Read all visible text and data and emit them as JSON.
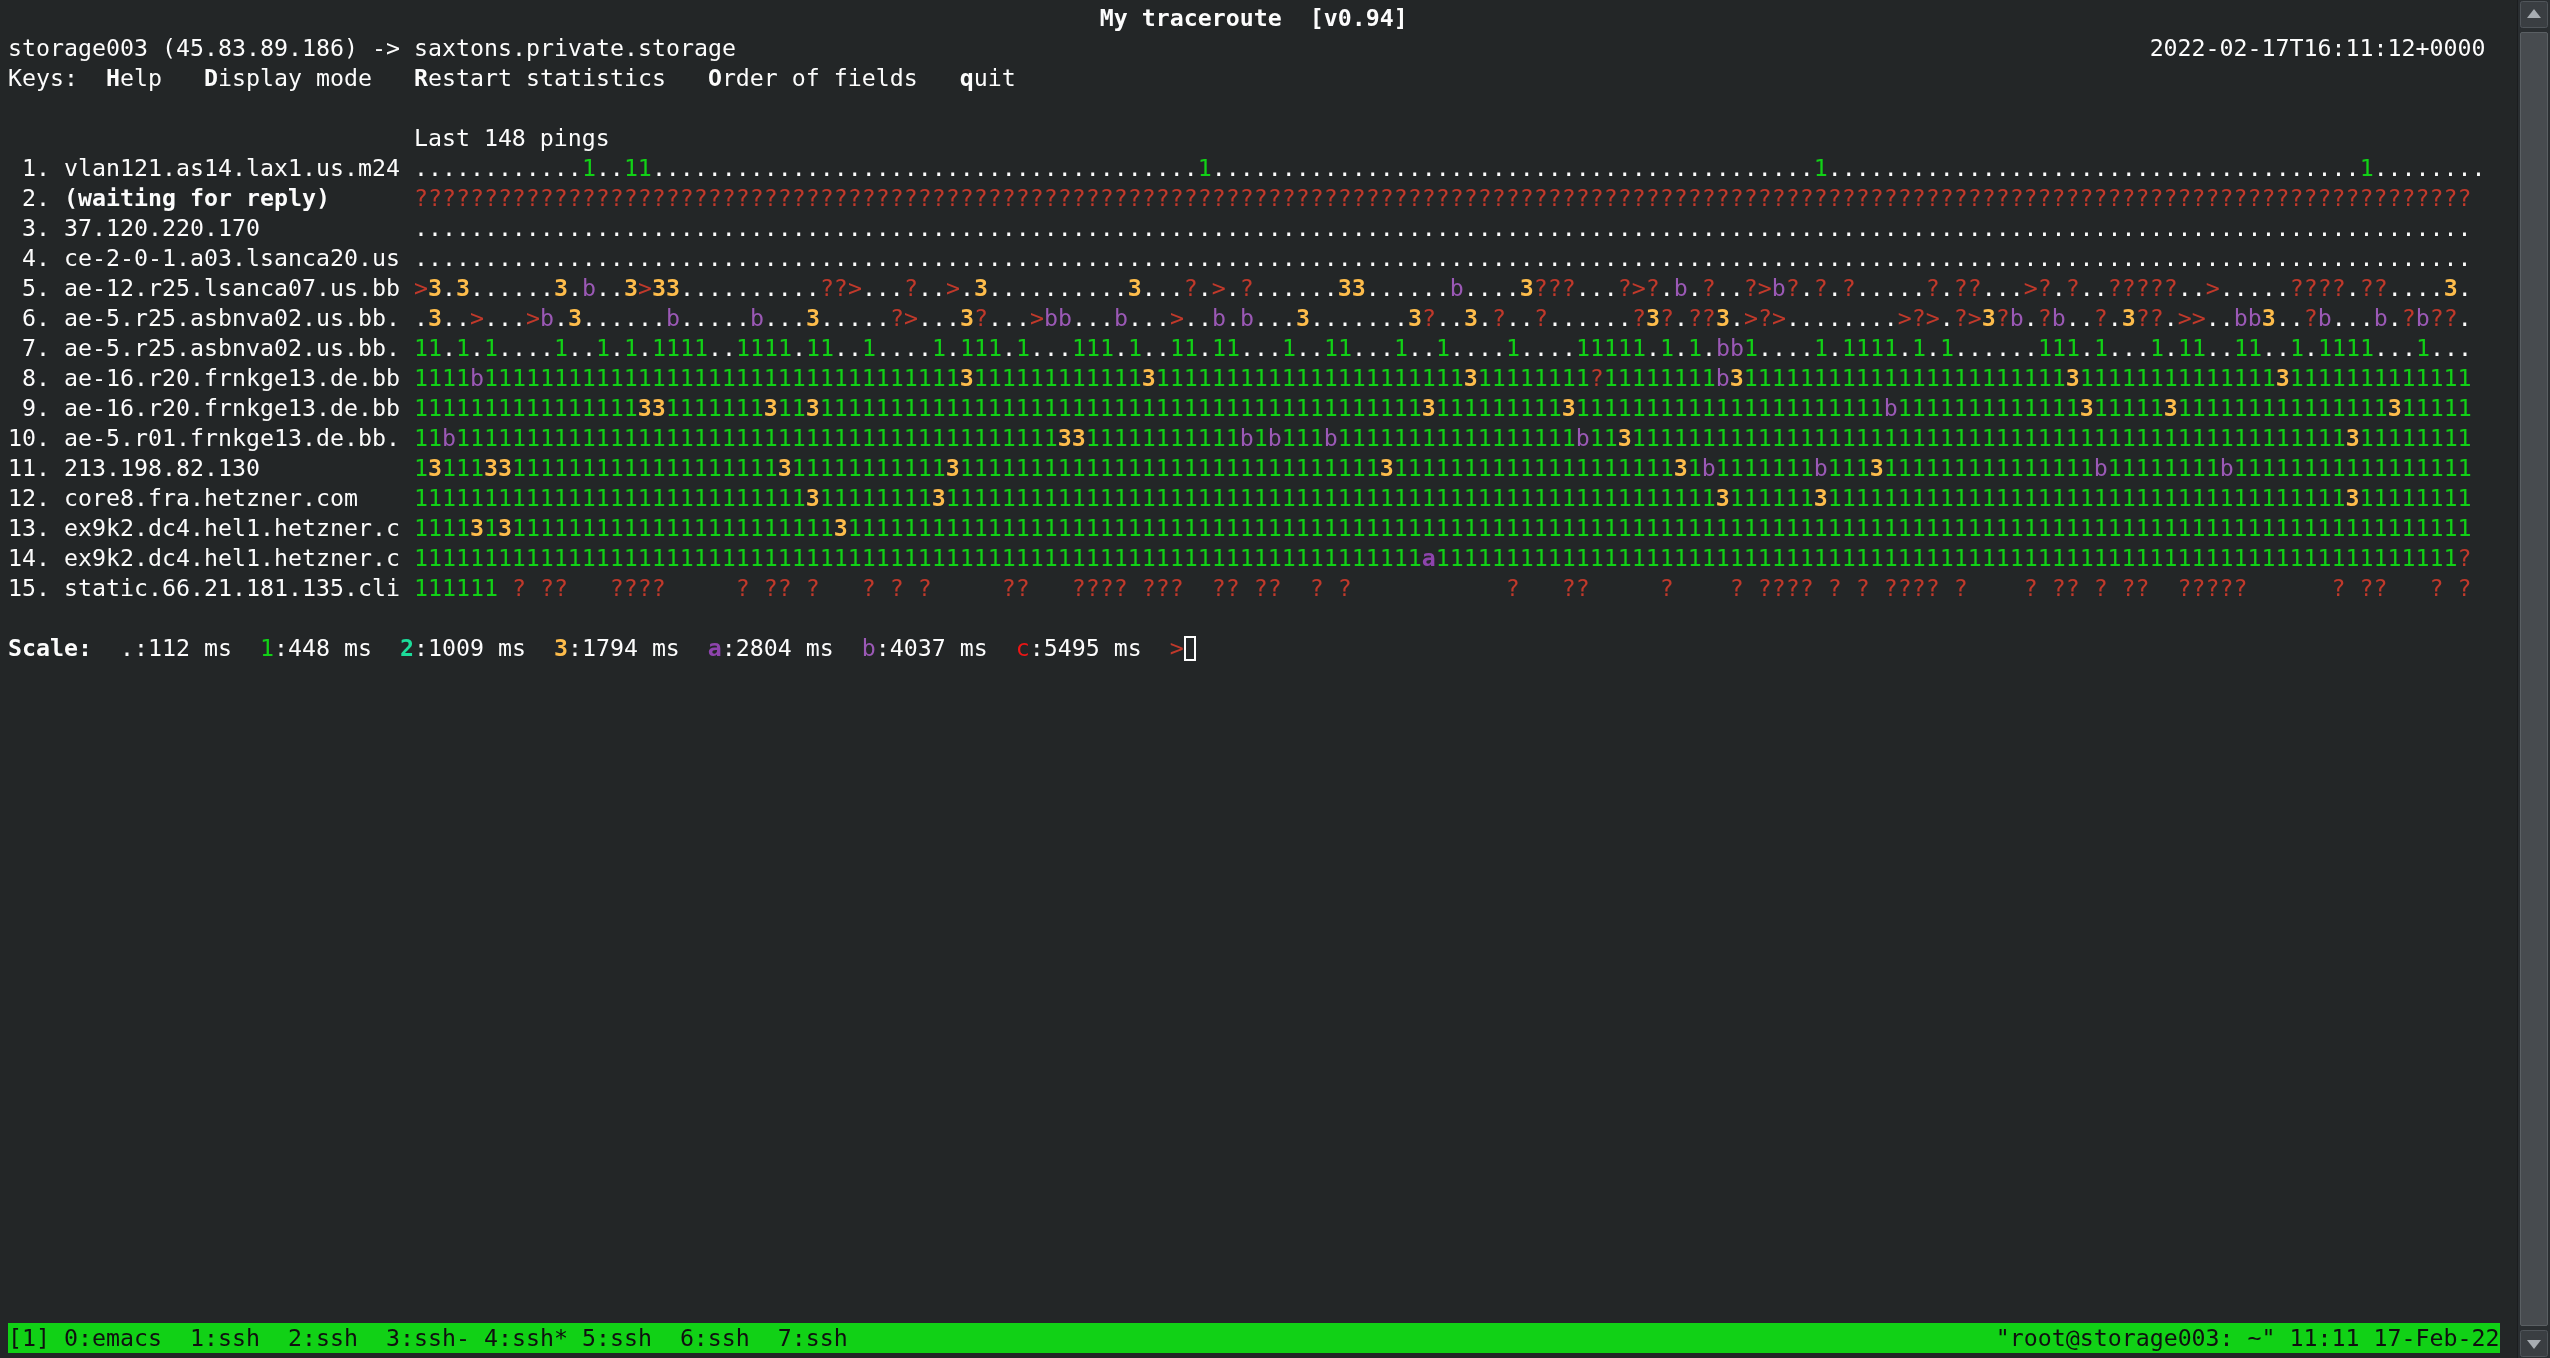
{
  "title": "My traceroute  [v0.94]",
  "route": "storage003 (45.83.89.186) -> saxtons.private.storage",
  "timestamp": "2022-02-17T16:11:12+0000",
  "keys": {
    "label": "Keys:",
    "items": [
      "**H**elp",
      "**D**isplay mode",
      "**R**estart statistics",
      "**O**rder of fields",
      "**q**uit"
    ]
  },
  "ping_header": "Last 148 pings",
  "hops": [
    {
      "number": "1.",
      "kind": "host",
      "host": "vlan121.as14.lax1.us.m24",
      "pings": "............1..11.......................................1...........................................1......................................1........"
    },
    {
      "number": "2.",
      "kind": "waiting",
      "host": "(waiting for reply)",
      "pings": "???????????????????????????????????????????????????????????????????????????????????????????????????????????????????????????????????????????????????"
    },
    {
      "number": "3.",
      "kind": "host",
      "host": "37.120.220.170",
      "pings": "..................................................................................................................................................."
    },
    {
      "number": "4.",
      "kind": "host",
      "host": "ce-2-0-1.a03.lsanca20.us",
      "pings": "..................................................................................................................................................."
    },
    {
      "number": "5.",
      "kind": "host",
      "host": "ae-12.r25.lsanca07.us.bb",
      "pings": ">3.3......3.b..3>33..........??>...?..>.3..........3...?.>.?......33......b....3???...?>?.b.?..?>b?.?.?.....?.??...>?.?..?????..>.....????.??....3."
    },
    {
      "number": "6.",
      "kind": "host",
      "host": "ae-5.r25.asbnva02.us.bb.",
      "pings": ".3..>...>b.3......b.....b...3.....?>...3?...>bb...b...>..b.b...3.......3?..3.?..?......?3?.??3.>?>........>?>.?>3?b.?b..?.3??.>>..bb3..?b...b.?b??."
    },
    {
      "number": "7.",
      "kind": "host",
      "host": "ae-5.r25.asbnva02.us.bb.",
      "pings": "11.1.1....1..1.1.1111..1111.11..1....1.111.1...111.1..11.11...1..11...1..1....1....11111.1.1.bb1....1.1111.1.1......111.1...1.11..11..1.1111...1..."
    },
    {
      "number": "8.",
      "kind": "host",
      "host": "ae-16.r20.frnkge13.de.bb",
      "pings": "1111b1111111111111111111111111111111111311111111111131111111111111111111111311111111?11111111b31111111111111111111111131111111111111131111111111111"
    },
    {
      "number": "9.",
      "kind": "host",
      "host": "ae-16.r20.frnkge13.de.bb",
      "pings": "111111111111111133111111131131111111111111111111111111111111111111111111311111111131111111111111111111111b11111111111113111113111111111111111311111"
    },
    {
      "number": "10.",
      "kind": "host",
      "host": "ae-5.r01.frnkge13.de.bb.",
      "pings": "11b11111111111111111111111111111111111111111113311111111111b1b111b11111111111111111b113111111111111111111111111111111111111111111111111111311111111"
    },
    {
      "number": "11.",
      "kind": "host",
      "host": "213.198.82.130",
      "pings": "13111331111111111111111111311111111111311111111111111111111111111111131111111111111111111131b1111111b1113111111111111111b11111111b11111111111111111"
    },
    {
      "number": "12.",
      "kind": "host",
      "host": "core8.fra.hetzner.com",
      "pings": "111111111111111111111111111131111111131111111111111111111111111111111111111111111111111111111311111131111111111111111111111111111111111111311111111"
    },
    {
      "number": "13.",
      "kind": "host",
      "host": "ex9k2.dc4.hel1.hetzner.c",
      "pings": "111131311111111111111111111111311111111111111111111111111111111111111111111111111111111111111111111111111111111111111111111111111111111111111111111"
    },
    {
      "number": "14.",
      "kind": "host",
      "host": "ex9k2.dc4.hel1.hetzner.c",
      "pings": "111111111111111111111111111111111111111111111111111111111111111111111111a1111111111111111111111111111111111111111111111111111111111111111111111111?"
    },
    {
      "number": "15.",
      "kind": "host",
      "host": "static.66.21.181.135.cli",
      "pings": "111111 ? ??   ????     ? ?? ?   ? ? ?     ??   ???? ???  ?? ??  ? ?           ?   ??     ?    ? ???? ? ? ???? ?    ? ?? ? ??  ?????      ? ??   ? ?"
    }
  ],
  "scale": {
    "label": "Scale:",
    "items": [
      {
        "kind": "level",
        "symbol": ".",
        "range": ":112 ms",
        "color": "#fcfcfc",
        "bold": false
      },
      {
        "kind": "level",
        "symbol": "1",
        "range": ":448 ms",
        "color": "#11d116",
        "bold": false
      },
      {
        "kind": "level",
        "symbol": "2",
        "range": ":1009 ms",
        "color": "#1cdc9a",
        "bold": true
      },
      {
        "kind": "level",
        "symbol": "3",
        "range": ":1794 ms",
        "color": "#fdbc4b",
        "bold": true
      },
      {
        "kind": "level",
        "symbol": "a",
        "range": ":2804 ms",
        "color": "#8e44ad",
        "bold": true
      },
      {
        "kind": "level",
        "symbol": "b",
        "range": ":4037 ms",
        "color": "#9b59b6",
        "bold": false
      },
      {
        "kind": "level",
        "symbol": "c",
        "range": ":5495 ms",
        "color": "#ed1515",
        "bold": false
      },
      {
        "kind": "overflow",
        "symbol": ">",
        "color": "#c0392b",
        "bold": false
      }
    ]
  },
  "status_bar": {
    "session": "[1]",
    "windows": [
      {
        "label": "0:emacs"
      },
      {
        "label": "1:ssh"
      },
      {
        "label": "2:ssh"
      },
      {
        "label": "3:ssh",
        "flag": "-"
      },
      {
        "label": "4:ssh",
        "flag": "*"
      },
      {
        "label": "5:ssh"
      },
      {
        "label": "6:ssh"
      },
      {
        "label": "7:ssh"
      }
    ],
    "pane_title": "\"root@storage003: ~\"",
    "time": "11:11",
    "date": "17-Feb-22"
  }
}
